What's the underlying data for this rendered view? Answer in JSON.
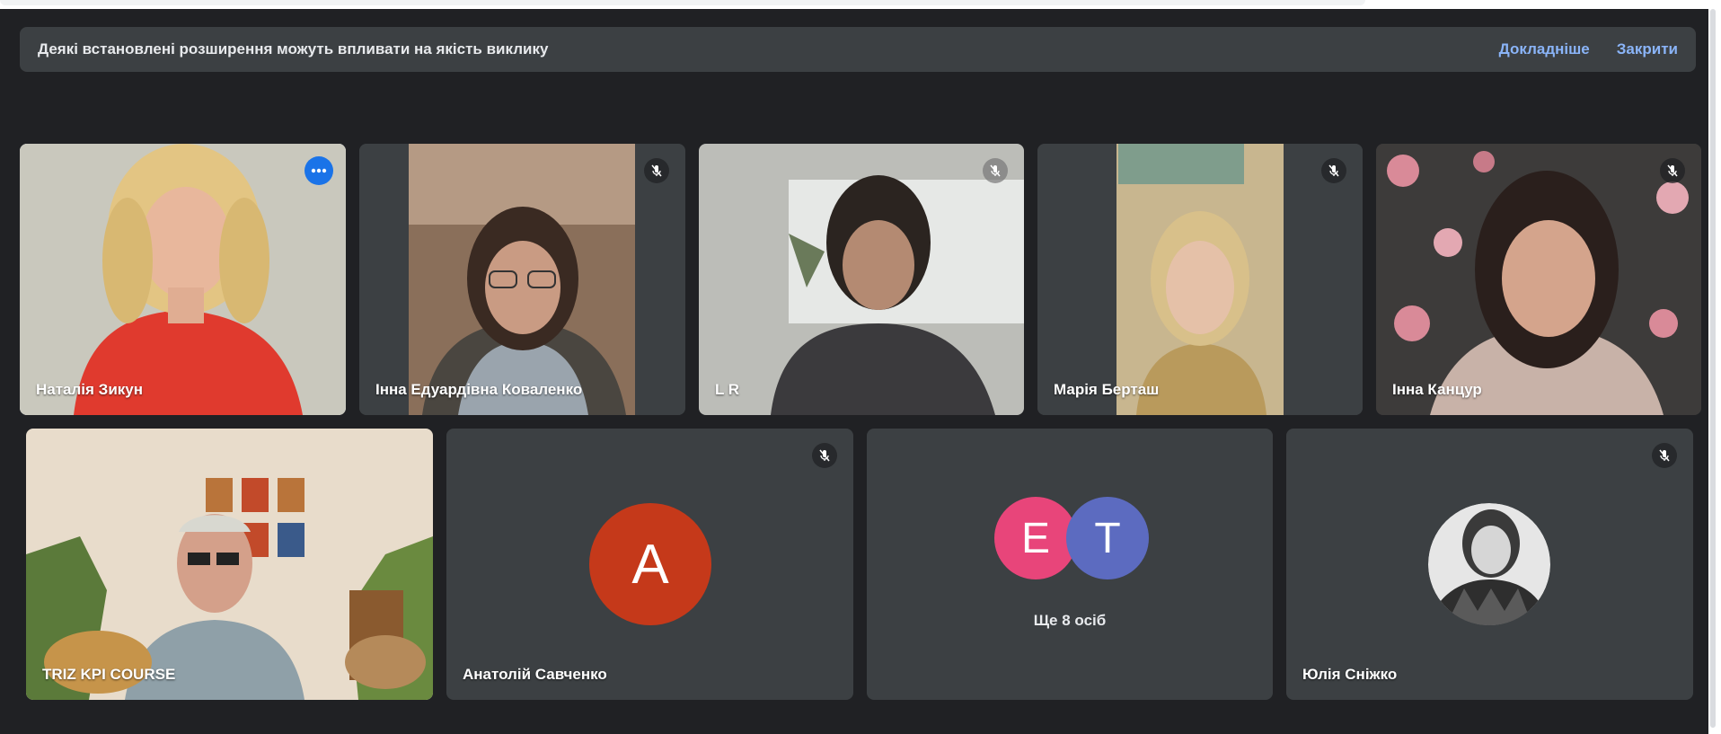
{
  "banner": {
    "text": "Деякі встановлені розширення можуть впливати на якість виклику",
    "learn_more": "Докладніше",
    "close": "Закрити"
  },
  "participants": {
    "p1": {
      "name": "Наталія Зикун"
    },
    "p2": {
      "name": "Інна Едуардівна Коваленко"
    },
    "p3": {
      "name": "L R"
    },
    "p4": {
      "name": "Марія Берташ"
    },
    "p5": {
      "name": "Інна Канцур"
    },
    "p6": {
      "name": "TRIZ KPI COURSE"
    },
    "p7": {
      "name": "Анатолій Савченко",
      "initial": "А",
      "avatar_color": "#c5391a"
    },
    "p8": {
      "initials": [
        "E",
        "T"
      ],
      "colors": [
        "#e8457a",
        "#5c6bc0"
      ],
      "more_label": "Ще 8 осіб"
    },
    "p9": {
      "name": "Юлія Сніжко"
    }
  },
  "colors": {
    "background": "#202124",
    "tile": "#3c4043",
    "active_outline": "#8ab4f8",
    "link": "#8ab4f8"
  }
}
